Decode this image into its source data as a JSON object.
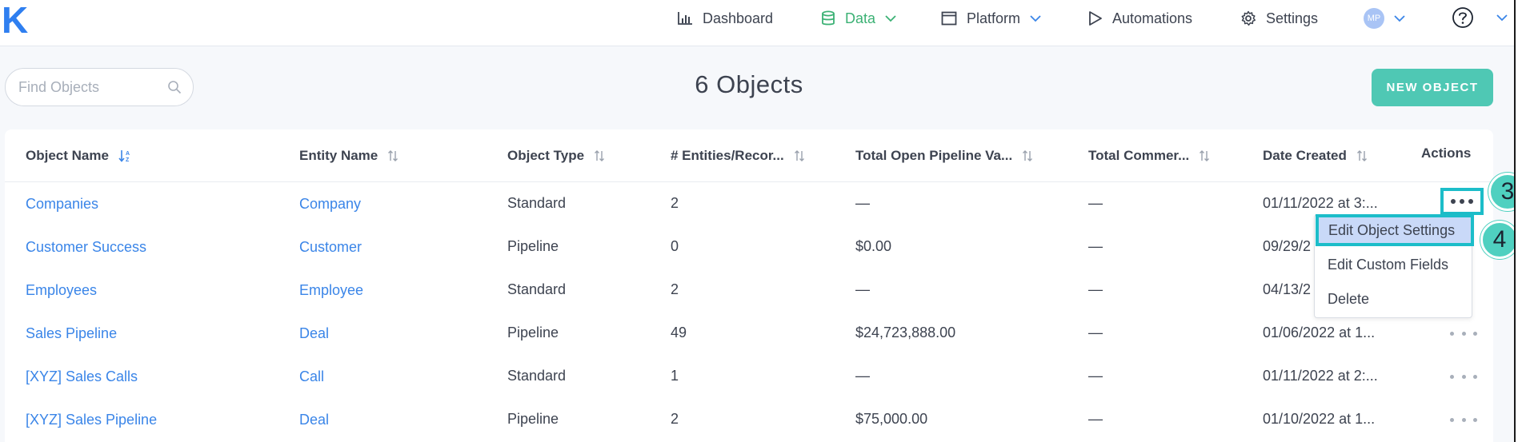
{
  "nav": {
    "logo": "K",
    "items": [
      {
        "label": "Dashboard",
        "icon": "bar-chart-icon"
      },
      {
        "label": "Data",
        "icon": "database-icon",
        "active": true
      },
      {
        "label": "Platform",
        "icon": "window-icon"
      },
      {
        "label": "Automations",
        "icon": "play-icon"
      },
      {
        "label": "Settings",
        "icon": "gear-icon"
      }
    ],
    "avatar_initials": "MP",
    "help_icon": "help-circle-icon"
  },
  "toolbar": {
    "search_placeholder": "Find Objects",
    "title": "6 Objects",
    "new_button": "NEW OBJECT"
  },
  "table": {
    "columns": [
      "Object Name",
      "Entity Name",
      "Object Type",
      "# Entities/Recor...",
      "Total Open Pipeline Va...",
      "Total Commer...",
      "Date Created",
      "Actions"
    ],
    "rows": [
      {
        "object_name": "Companies",
        "entity_name": "Company",
        "object_type": "Standard",
        "entities": "2",
        "pipeline_value": "—",
        "commercial": "—",
        "date_created": "01/11/2022 at 3:..."
      },
      {
        "object_name": "Customer Success",
        "entity_name": "Customer",
        "object_type": "Pipeline",
        "entities": "0",
        "pipeline_value": "$0.00",
        "commercial": "—",
        "date_created": "09/29/2"
      },
      {
        "object_name": "Employees",
        "entity_name": "Employee",
        "object_type": "Standard",
        "entities": "2",
        "pipeline_value": "—",
        "commercial": "—",
        "date_created": "04/13/2"
      },
      {
        "object_name": "Sales Pipeline",
        "entity_name": "Deal",
        "object_type": "Pipeline",
        "entities": "49",
        "pipeline_value": "$24,723,888.00",
        "commercial": "—",
        "date_created": "01/06/2022 at 1..."
      },
      {
        "object_name": "[XYZ] Sales Calls",
        "entity_name": "Call",
        "object_type": "Standard",
        "entities": "1",
        "pipeline_value": "—",
        "commercial": "—",
        "date_created": "01/11/2022 at 2:..."
      },
      {
        "object_name": "[XYZ] Sales Pipeline",
        "entity_name": "Deal",
        "object_type": "Pipeline",
        "entities": "2",
        "pipeline_value": "$75,000.00",
        "commercial": "—",
        "date_created": "01/10/2022 at 1..."
      }
    ]
  },
  "menu": {
    "items": [
      "Edit Object Settings",
      "Edit Custom Fields",
      "Delete"
    ]
  },
  "badges": [
    "3",
    "4"
  ],
  "colors": {
    "accent_link": "#3a85e8",
    "nav_active": "#3bb174",
    "primary_button": "#4fc8b4",
    "highlight_border": "#1cbdc9",
    "badge": "#4fd0c0"
  }
}
